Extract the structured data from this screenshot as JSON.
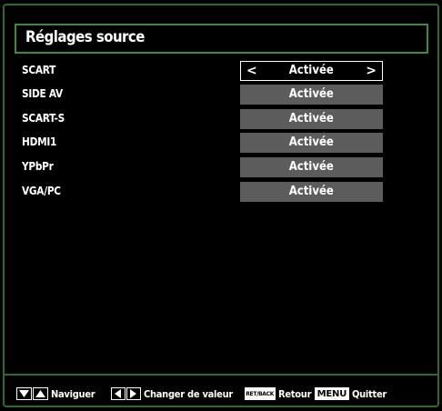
{
  "header": {
    "title": "Réglages source"
  },
  "sources": [
    {
      "label": "SCART",
      "value": "Activée",
      "selected": true
    },
    {
      "label": "SIDE AV",
      "value": "Activée",
      "selected": false
    },
    {
      "label": "SCART-S",
      "value": "Activée",
      "selected": false
    },
    {
      "label": "HDMI1",
      "value": "Activée",
      "selected": false
    },
    {
      "label": "YPbPr",
      "value": "Activée",
      "selected": false
    },
    {
      "label": "VGA/PC",
      "value": "Activée",
      "selected": false
    }
  ],
  "footer": {
    "navigate": "Naviguer",
    "change_value": "Changer de valeur",
    "back_key": "RET/BACK",
    "back": "Retour",
    "menu_key": "MENU",
    "quit": "Quitter"
  },
  "icons": {
    "up_down": "up-down-arrows-icon",
    "left_right": "left-right-arrows-icon"
  },
  "colors": {
    "frame": "#2c6b2c",
    "title_border": "#3c8b3c",
    "value_bg": "#5c5c5c",
    "background": "#000000"
  }
}
